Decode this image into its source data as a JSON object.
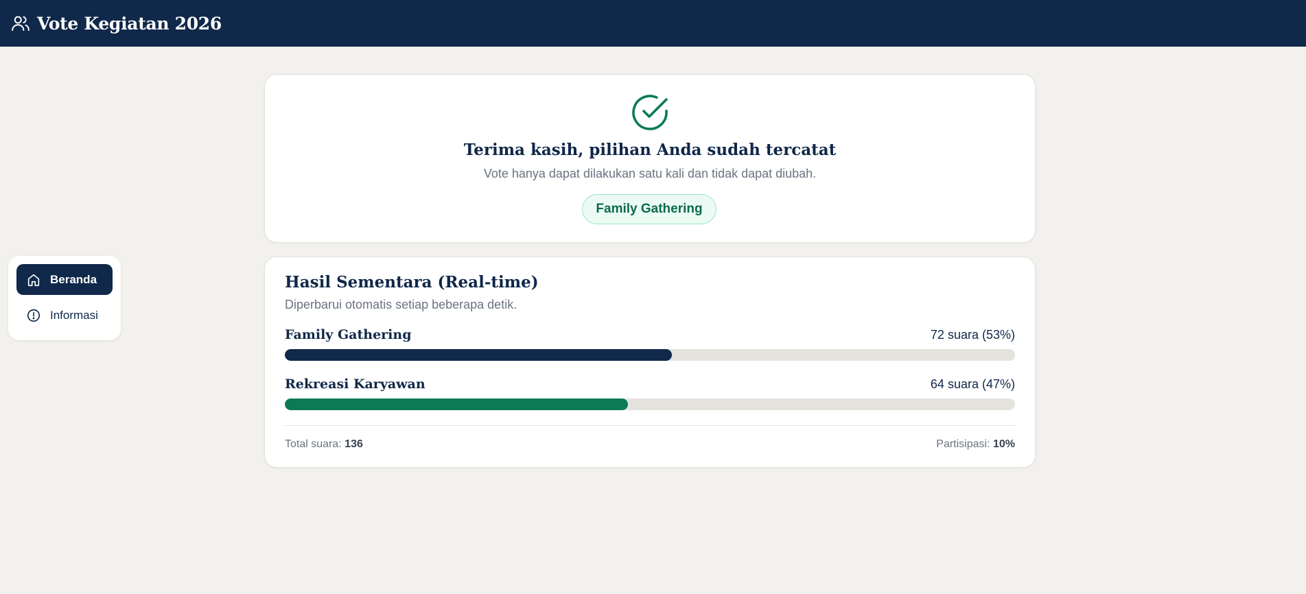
{
  "app": {
    "title": "Vote Kegiatan 2026",
    "icon": "users-icon"
  },
  "sidebar": {
    "items": [
      {
        "label": "Beranda",
        "icon": "home-icon",
        "active": true
      },
      {
        "label": "Informasi",
        "icon": "info-circle-icon",
        "active": false
      }
    ]
  },
  "confirmation": {
    "icon": "check-circle-icon",
    "title": "Terima kasih, pilihan Anda sudah tercatat",
    "subtitle": "Vote hanya dapat dilakukan satu kali dan tidak dapat diubah.",
    "selected_choice": "Family Gathering"
  },
  "results": {
    "title": "Hasil Sementara (Real-time)",
    "subtitle": "Diperbarui otomatis setiap beberapa detik.",
    "options": [
      {
        "name": "Family Gathering",
        "votes": 72,
        "percent": 53,
        "count_text": "72 suara (53%)",
        "color": "#10284a"
      },
      {
        "name": "Rekreasi Karyawan",
        "votes": 64,
        "percent": 47,
        "count_text": "64 suara (47%)",
        "color": "#0b7a55"
      }
    ],
    "total_label": "Total suara:",
    "total_value": "136",
    "participation_label": "Partisipasi:",
    "participation_value": "10%"
  },
  "colors": {
    "header_bg": "#10284a",
    "accent_green": "#0b7a55",
    "page_bg": "#f3f1ed"
  }
}
